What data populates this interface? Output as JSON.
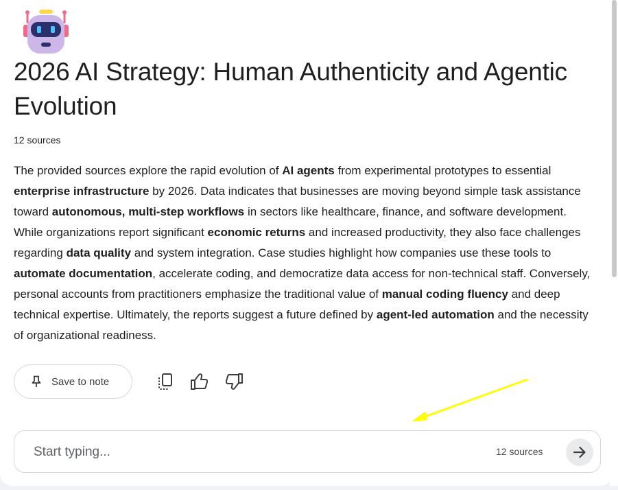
{
  "note": {
    "title": "2026 AI Strategy: Human Authenticity and Agentic Evolution",
    "source_count": "12 sources",
    "summary": [
      {
        "text": "The provided sources explore the rapid evolution of ",
        "bold": false
      },
      {
        "text": "AI agents",
        "bold": true
      },
      {
        "text": " from experimental prototypes to essential ",
        "bold": false
      },
      {
        "text": "enterprise infrastructure",
        "bold": true
      },
      {
        "text": " by 2026. Data indicates that businesses are moving beyond simple task assistance toward ",
        "bold": false
      },
      {
        "text": "autonomous, multi-step workflows",
        "bold": true
      },
      {
        "text": " in sectors like healthcare, finance, and software development. While organizations report significant ",
        "bold": false
      },
      {
        "text": "economic returns",
        "bold": true
      },
      {
        "text": " and increased productivity, they also face challenges regarding ",
        "bold": false
      },
      {
        "text": "data quality",
        "bold": true
      },
      {
        "text": " and system integration. Case studies highlight how companies use these tools to ",
        "bold": false
      },
      {
        "text": "automate documentation",
        "bold": true
      },
      {
        "text": ", accelerate coding, and democratize data access for non-technical staff. Conversely, personal accounts from practitioners emphasize the traditional value of ",
        "bold": false
      },
      {
        "text": "manual coding fluency",
        "bold": true
      },
      {
        "text": " and deep technical expertise. Ultimately, the reports suggest a future defined by ",
        "bold": false
      },
      {
        "text": "agent-led automation",
        "bold": true
      },
      {
        "text": " and the necessity of organizational readiness.",
        "bold": false
      }
    ]
  },
  "actions": {
    "save_label": "Save to note",
    "icons": [
      "pin-icon",
      "copy-icon",
      "thumbs-up-icon",
      "thumbs-down-icon"
    ]
  },
  "composer": {
    "placeholder": "Start typing...",
    "value": "",
    "source_count": "12 sources",
    "send_icon": "arrow-right-icon"
  },
  "annotation": {
    "arrow_color": "#ffff00"
  },
  "colors": {
    "text": "#1f1f1f",
    "border": "#d4d6dc",
    "send_bg": "#e9eaec",
    "robot_body": "#d8c4ef",
    "robot_visor": "#2b2f6b",
    "robot_eyes": "#4cc3ff",
    "robot_accent": "#f06a8a"
  }
}
